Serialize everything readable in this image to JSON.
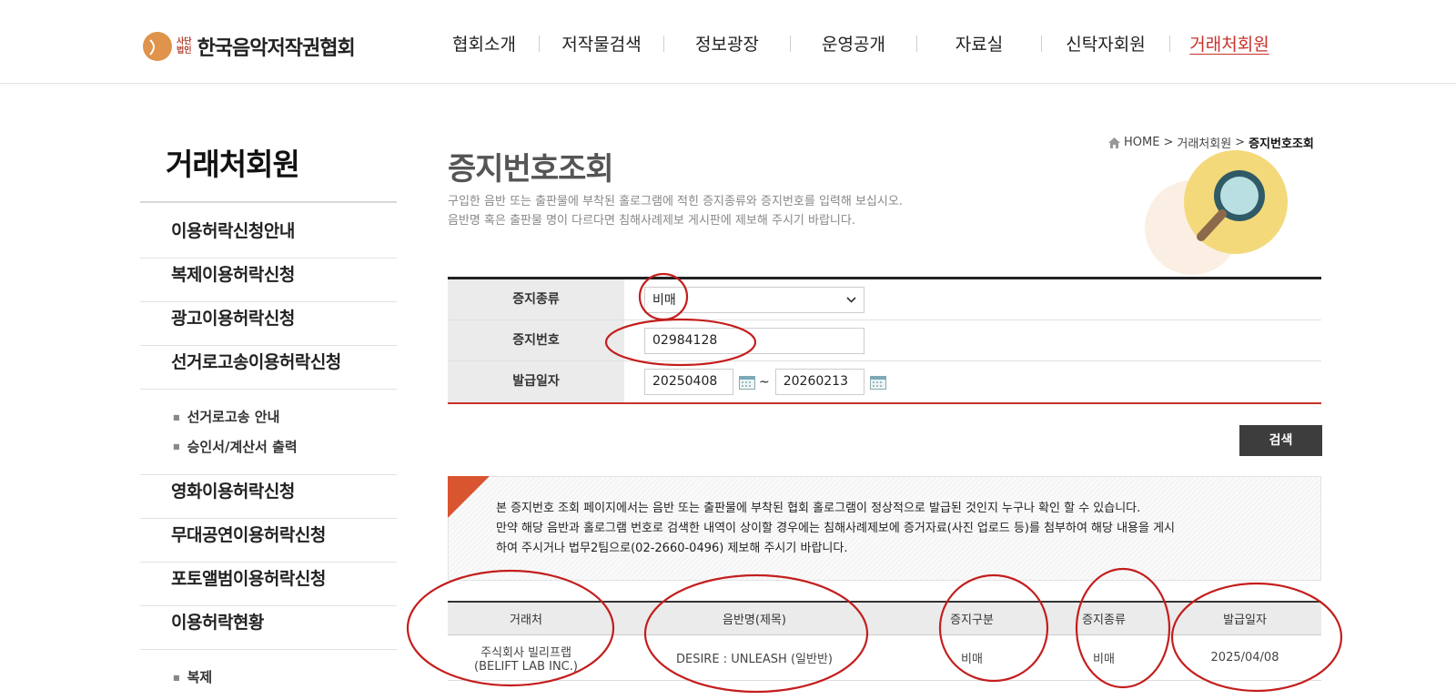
{
  "header": {
    "logo_small_1": "사단",
    "logo_small_2": "법인",
    "logo_text": "한국음악저작권협회",
    "nav": [
      "협회소개",
      "저작물검색",
      "정보광장",
      "운영공개",
      "자료실",
      "신탁자회원",
      "거래처회원"
    ]
  },
  "sidebar": {
    "title": "거래처회원",
    "items": [
      "이용허락신청안내",
      "복제이용허락신청",
      "광고이용허락신청",
      "선거로고송이용허락신청"
    ],
    "sub_items": [
      "선거로고송 안내",
      "승인서/계산서 출력"
    ],
    "items2": [
      "영화이용허락신청",
      "무대공연이용허락신청",
      "포토앨범이용허락신청",
      "이용허락현황"
    ],
    "sub_items2": [
      "복제"
    ]
  },
  "breadcrumb": {
    "home": "HOME",
    "parent": "거래처회원",
    "current": "증지번호조회"
  },
  "page": {
    "title": "증지번호조회",
    "desc1": "구입한 음반 또는 출판물에 부착된 홀로그램에 적힌 증지종류와 증지번호를 입력해 보십시오.",
    "desc2": "음반명 혹은 출판물 명이 다르다면 침해사례제보 게시판에 제보해 주시기 바랍니다."
  },
  "form": {
    "type_label": "증지종류",
    "type_value": "비매",
    "number_label": "증지번호",
    "number_value": "02984128",
    "date_label": "발급일자",
    "date_from": "20250408",
    "date_sep": "~",
    "date_to": "20260213"
  },
  "search_label": "검색",
  "notice": {
    "line1": "본 증지번호 조회 페이지에서는 음반 또는 출판물에 부착된 협회 홀로그램이 정상적으로 발급된 것인지 누구나 확인 할 수 있습니다.",
    "line2": "만약 해당 음반과 홀로그램 번호로 검색한 내역이 상이할 경우에는 침해사례제보에 증거자료(사진 업로드 등)를 첨부하여 해당 내용을 게시",
    "line3": "하여 주시거나 법무2팀으로(02-2660-0496) 제보해 주시기 바랍니다."
  },
  "results": {
    "headers": [
      "거래처",
      "음반명(제목)",
      "증지구분",
      "증지종류",
      "발급일자"
    ],
    "row": {
      "client_1": "주식회사 빌리프랩",
      "client_2": "(BELIFT LAB INC.)",
      "album": "DESIRE : UNLEASH (일반반)",
      "category": "비매",
      "type": "비매",
      "date": "2025/04/08"
    }
  },
  "colors": {
    "accent": "#c8322a",
    "annotation": "#c41e1e",
    "corner": "#d9552f"
  }
}
